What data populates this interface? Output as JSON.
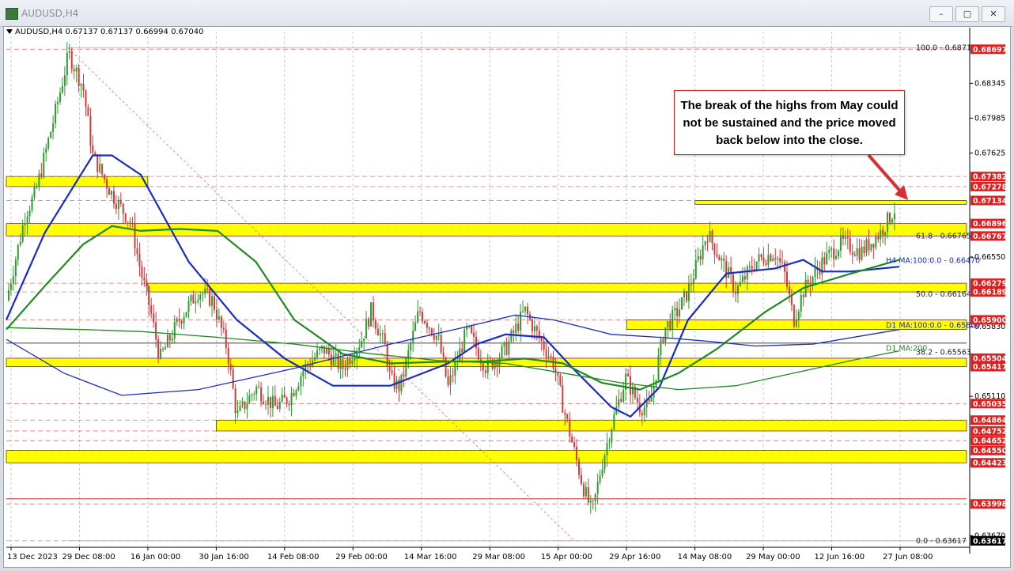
{
  "window": {
    "title": "AUDUSD,H4",
    "minimize": "–",
    "maximize": "▢",
    "close": "✕"
  },
  "legend": {
    "symbol": "AUDUSD,H4",
    "ohlc": "0.67137 0.67137 0.66994 0.67040"
  },
  "annotation": {
    "lines": [
      "The break of the highs from May could",
      "not be sustained and the price moved",
      "back below into the close."
    ]
  },
  "colors": {
    "bull": "#2e9b2e",
    "bear": "#d33a3a",
    "zone": "#ffff00",
    "ma_blue": "#1a2bc0",
    "ma_green": "#1f8a1f",
    "level": "#e03030"
  },
  "chart_data": {
    "type": "candlestick",
    "symbol": "AUDUSD",
    "timeframe": "H4",
    "ylim": [
      0.6355,
      0.6883
    ],
    "x_ticks": [
      "13 Dec 2023",
      "29 Dec 08:00",
      "16 Jan 00:00",
      "30 Jan 16:00",
      "14 Feb 08:00",
      "29 Feb 00:00",
      "14 Mar 16:00",
      "29 Mar 08:00",
      "15 Apr 00:00",
      "29 Apr 16:00",
      "14 May 08:00",
      "29 May 00:00",
      "12 Jun 16:00",
      "27 Jun 08:00"
    ],
    "y_ticks": [
      "0.68345",
      "0.67985",
      "0.67625",
      "0.66550",
      "0.65830",
      "0.65110",
      "0.63670"
    ],
    "price_tags": [
      {
        "label": "0.68697",
        "value": 0.68697,
        "kind": "red"
      },
      {
        "label": "0.67382",
        "value": 0.67382,
        "kind": "red"
      },
      {
        "label": "0.67278",
        "value": 0.67278,
        "kind": "red"
      },
      {
        "label": "0.67134",
        "value": 0.67134,
        "kind": "red"
      },
      {
        "label": "0.66896",
        "value": 0.66896,
        "kind": "red"
      },
      {
        "label": "0.66767",
        "value": 0.66767,
        "kind": "red"
      },
      {
        "label": "0.66279",
        "value": 0.66279,
        "kind": "red"
      },
      {
        "label": "0.66189",
        "value": 0.66189,
        "kind": "red"
      },
      {
        "label": "0.65900",
        "value": 0.659,
        "kind": "red"
      },
      {
        "label": "0.65504",
        "value": 0.65504,
        "kind": "red"
      },
      {
        "label": "0.65417",
        "value": 0.65417,
        "kind": "red"
      },
      {
        "label": "0.65035",
        "value": 0.65035,
        "kind": "red"
      },
      {
        "label": "0.64864",
        "value": 0.64864,
        "kind": "red"
      },
      {
        "label": "0.64752",
        "value": 0.64752,
        "kind": "red"
      },
      {
        "label": "0.64652",
        "value": 0.64652,
        "kind": "red"
      },
      {
        "label": "0.64550",
        "value": 0.6455,
        "kind": "red"
      },
      {
        "label": "0.64423",
        "value": 0.64423,
        "kind": "red"
      },
      {
        "label": "0.63998",
        "value": 0.63998,
        "kind": "red"
      },
      {
        "label": "0.63617",
        "value": 0.63617,
        "kind": "black"
      }
    ],
    "zones": [
      {
        "from": 0.67278,
        "to": 0.67382,
        "start": "13 Dec 2023",
        "end": "16 Jan 00:00"
      },
      {
        "from": 0.67095,
        "to": 0.67134,
        "start": "14 May 08:00",
        "end": "27 Jun 08:00"
      },
      {
        "from": 0.66767,
        "to": 0.66896,
        "start": "13 Dec 2023",
        "end": "27 Jun 08:00"
      },
      {
        "from": 0.66189,
        "to": 0.66279,
        "start": "16 Jan 00:00",
        "end": "27 Jun 08:00"
      },
      {
        "from": 0.658,
        "to": 0.659,
        "start": "29 Apr 16:00",
        "end": "27 Jun 08:00"
      },
      {
        "from": 0.65417,
        "to": 0.65504,
        "start": "13 Dec 2023",
        "end": "27 Jun 08:00"
      },
      {
        "from": 0.64752,
        "to": 0.64864,
        "start": "30 Jan 16:00",
        "end": "27 Jun 08:00"
      },
      {
        "from": 0.64423,
        "to": 0.6455,
        "start": "13 Dec 2023",
        "end": "27 Jun 08:00"
      }
    ],
    "fib_labels": [
      {
        "text": "100.0 - 0.68710",
        "value": 0.6871
      },
      {
        "text": "61.8 - 0.66765",
        "value": 0.66765
      },
      {
        "text": "50.0 - 0.66164",
        "value": 0.66164
      },
      {
        "text": "38.2 - 0.65563",
        "value": 0.65563
      },
      {
        "text": "0.0 - 0.63617",
        "value": 0.63617
      }
    ],
    "ma_labels": [
      {
        "text": "H4 MA:100:0.0 - 0.66470",
        "value": 0.6647,
        "color": "#1a2bc0"
      },
      {
        "text": "D1 MA:100:0.0 - 0.65800",
        "value": 0.658,
        "color": "#1a2bc0"
      },
      {
        "text": "D1 MA:200",
        "value": 0.65563,
        "color": "#1f8a1f"
      }
    ],
    "series": [
      {
        "name": "H4 MA 100",
        "color": "#1a2bc0",
        "points": [
          [
            0,
            0.659
          ],
          [
            0.04,
            0.668
          ],
          [
            0.09,
            0.676
          ],
          [
            0.11,
            0.676
          ],
          [
            0.14,
            0.674
          ],
          [
            0.19,
            0.665
          ],
          [
            0.24,
            0.659
          ],
          [
            0.29,
            0.655
          ],
          [
            0.34,
            0.6522
          ],
          [
            0.4,
            0.6522
          ],
          [
            0.46,
            0.6545
          ],
          [
            0.49,
            0.6565
          ],
          [
            0.52,
            0.6575
          ],
          [
            0.56,
            0.6572
          ],
          [
            0.59,
            0.654
          ],
          [
            0.63,
            0.65
          ],
          [
            0.65,
            0.649
          ],
          [
            0.68,
            0.652
          ],
          [
            0.71,
            0.659
          ],
          [
            0.75,
            0.6638
          ],
          [
            0.8,
            0.6643
          ],
          [
            0.83,
            0.6652
          ],
          [
            0.85,
            0.664
          ],
          [
            0.88,
            0.664
          ],
          [
            0.93,
            0.6645
          ]
        ]
      },
      {
        "name": "H4 MA 200",
        "color": "#1f8a1f",
        "points": [
          [
            0,
            0.658
          ],
          [
            0.04,
            0.6625
          ],
          [
            0.08,
            0.6668
          ],
          [
            0.11,
            0.6687
          ],
          [
            0.14,
            0.6682
          ],
          [
            0.18,
            0.6684
          ],
          [
            0.22,
            0.6682
          ],
          [
            0.26,
            0.665
          ],
          [
            0.3,
            0.659
          ],
          [
            0.35,
            0.6555
          ],
          [
            0.4,
            0.6545
          ],
          [
            0.46,
            0.6547
          ],
          [
            0.5,
            0.6547
          ],
          [
            0.54,
            0.655
          ],
          [
            0.58,
            0.6545
          ],
          [
            0.62,
            0.6525
          ],
          [
            0.66,
            0.6518
          ],
          [
            0.7,
            0.6535
          ],
          [
            0.74,
            0.656
          ],
          [
            0.79,
            0.6598
          ],
          [
            0.83,
            0.6623
          ],
          [
            0.88,
            0.6638
          ],
          [
            0.93,
            0.6652
          ]
        ]
      },
      {
        "name": "D1 MA 100",
        "color": "#1a2bc0",
        "points": [
          [
            0,
            0.657
          ],
          [
            0.06,
            0.6535
          ],
          [
            0.12,
            0.6512
          ],
          [
            0.2,
            0.6518
          ],
          [
            0.3,
            0.654
          ],
          [
            0.4,
            0.6565
          ],
          [
            0.48,
            0.6583
          ],
          [
            0.53,
            0.6595
          ],
          [
            0.57,
            0.659
          ],
          [
            0.63,
            0.6575
          ],
          [
            0.68,
            0.6572
          ],
          [
            0.73,
            0.6568
          ],
          [
            0.78,
            0.6563
          ],
          [
            0.84,
            0.6565
          ],
          [
            0.9,
            0.6575
          ],
          [
            0.93,
            0.658
          ]
        ]
      },
      {
        "name": "D1 MA 200",
        "color": "#1f8a1f",
        "points": [
          [
            0,
            0.6582
          ],
          [
            0.08,
            0.658
          ],
          [
            0.14,
            0.6578
          ],
          [
            0.22,
            0.6572
          ],
          [
            0.3,
            0.6565
          ],
          [
            0.38,
            0.6555
          ],
          [
            0.45,
            0.6548
          ],
          [
            0.52,
            0.6545
          ],
          [
            0.58,
            0.6535
          ],
          [
            0.64,
            0.6525
          ],
          [
            0.7,
            0.6518
          ],
          [
            0.76,
            0.6522
          ],
          [
            0.82,
            0.6535
          ],
          [
            0.88,
            0.6548
          ],
          [
            0.93,
            0.6558
          ]
        ]
      }
    ],
    "close_path": [
      [
        0,
        0.661
      ],
      [
        0.02,
        0.67
      ],
      [
        0.03,
        0.672
      ],
      [
        0.05,
        0.68
      ],
      [
        0.065,
        0.6865
      ],
      [
        0.08,
        0.683
      ],
      [
        0.09,
        0.676
      ],
      [
        0.11,
        0.672
      ],
      [
        0.13,
        0.669
      ],
      [
        0.14,
        0.664
      ],
      [
        0.15,
        0.66
      ],
      [
        0.16,
        0.655
      ],
      [
        0.18,
        0.659
      ],
      [
        0.2,
        0.662
      ],
      [
        0.215,
        0.661
      ],
      [
        0.23,
        0.656
      ],
      [
        0.24,
        0.649
      ],
      [
        0.26,
        0.652
      ],
      [
        0.28,
        0.65
      ],
      [
        0.295,
        0.651
      ],
      [
        0.31,
        0.654
      ],
      [
        0.33,
        0.656
      ],
      [
        0.35,
        0.654
      ],
      [
        0.37,
        0.657
      ],
      [
        0.38,
        0.66
      ],
      [
        0.395,
        0.656
      ],
      [
        0.4,
        0.6528
      ],
      [
        0.41,
        0.652
      ],
      [
        0.43,
        0.66
      ],
      [
        0.45,
        0.657
      ],
      [
        0.46,
        0.652
      ],
      [
        0.48,
        0.658
      ],
      [
        0.5,
        0.654
      ],
      [
        0.52,
        0.656
      ],
      [
        0.54,
        0.66
      ],
      [
        0.55,
        0.658
      ],
      [
        0.57,
        0.6545
      ],
      [
        0.58,
        0.65
      ],
      [
        0.59,
        0.646
      ],
      [
        0.6,
        0.642
      ],
      [
        0.61,
        0.639
      ],
      [
        0.62,
        0.644
      ],
      [
        0.63,
        0.648
      ],
      [
        0.645,
        0.653
      ],
      [
        0.66,
        0.65
      ],
      [
        0.67,
        0.65
      ],
      [
        0.685,
        0.658
      ],
      [
        0.7,
        0.66
      ],
      [
        0.71,
        0.662
      ],
      [
        0.73,
        0.668
      ],
      [
        0.75,
        0.664
      ],
      [
        0.76,
        0.662
      ],
      [
        0.78,
        0.665
      ],
      [
        0.8,
        0.666
      ],
      [
        0.81,
        0.664
      ],
      [
        0.82,
        0.659
      ],
      [
        0.83,
        0.662
      ],
      [
        0.85,
        0.665
      ],
      [
        0.87,
        0.667
      ],
      [
        0.89,
        0.666
      ],
      [
        0.91,
        0.668
      ],
      [
        0.925,
        0.6704
      ]
    ],
    "extra_lines": [
      {
        "value": 0.6566,
        "color": "#000000"
      },
      {
        "value": 0.6405,
        "color": "#c00000"
      }
    ]
  }
}
